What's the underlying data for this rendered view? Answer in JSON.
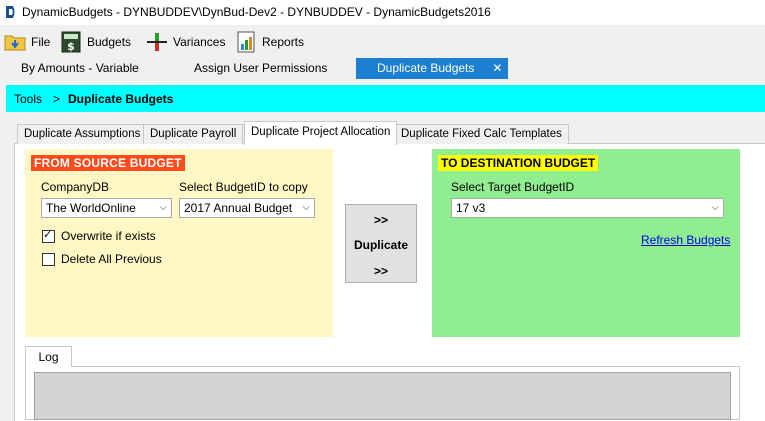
{
  "window": {
    "title": "DynamicBudgets - DYNBUDDEV\\DynBud-Dev2 - DYNBUDDEV - DynamicBudgets2016"
  },
  "menu": {
    "items": [
      {
        "label": "File",
        "icon": "folder-icon"
      },
      {
        "label": "Budgets",
        "icon": "calculator-icon"
      },
      {
        "label": "Variances",
        "icon": "variance-icon"
      },
      {
        "label": "Reports",
        "icon": "report-icon"
      }
    ]
  },
  "doc_tabs": [
    {
      "label": "By Amounts - Variable"
    },
    {
      "label": "Assign User Permissions"
    },
    {
      "label": "Duplicate Budgets",
      "active": true,
      "close": "✕"
    }
  ],
  "breadcrumb": {
    "root": "Tools",
    "separator": ">",
    "current": "Duplicate Budgets"
  },
  "sub_tabs": [
    {
      "label": "Duplicate Assumptions"
    },
    {
      "label": "Duplicate Payroll"
    },
    {
      "label": "Duplicate Project Allocation",
      "active": true
    },
    {
      "label": "Duplicate Fixed Calc Templates"
    }
  ],
  "source": {
    "header": "FROM SOURCE BUDGET",
    "company_label": "CompanyDB",
    "company_value": "The WorldOnline",
    "budget_label": "Select BudgetID to copy",
    "budget_value": "2017 Annual Budget",
    "overwrite_label": "Overwrite if exists",
    "overwrite_checked": true,
    "delete_label": "Delete All Previous",
    "delete_checked": false
  },
  "duplicate_button": {
    "top": ">>",
    "label": "Duplicate",
    "bottom": ">>"
  },
  "destination": {
    "header": "TO DESTINATION BUDGET",
    "target_label": "Select Target BudgetID",
    "target_value": "17 v3",
    "refresh_label": "Refresh Budgets"
  },
  "log": {
    "tab_label": "Log"
  },
  "colors": {
    "source_bg": "#fff8c5",
    "source_header": "#ff4a1c",
    "dest_bg": "#90ee90",
    "dest_header": "#ffff00",
    "breadcrumb_bg": "#00ffff",
    "active_tab": "#1c7fd0"
  }
}
